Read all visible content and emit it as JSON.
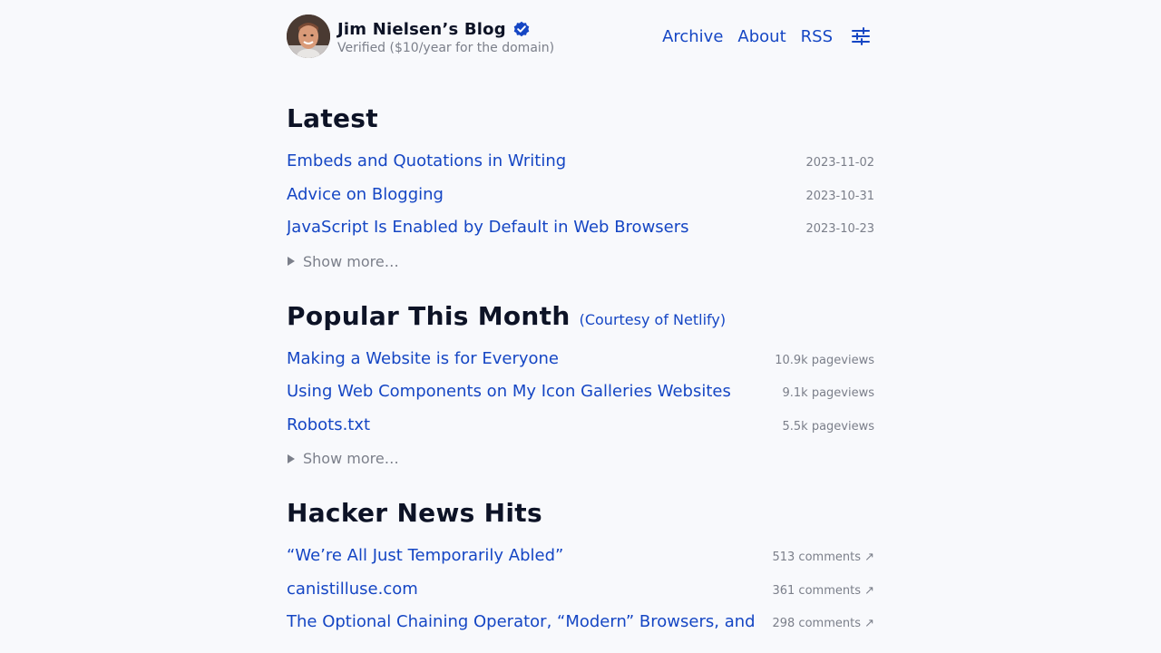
{
  "header": {
    "avatar_alt": "Jim Nielsen",
    "title": "Jim Nielsen’s Blog",
    "verified_icon": "verified-badge-icon",
    "subtitle": "Verified ($10/year for the domain)",
    "nav": {
      "archive": "Archive",
      "about": "About",
      "rss": "RSS",
      "settings_icon": "sliders-icon"
    }
  },
  "latest": {
    "heading": "Latest",
    "posts": [
      {
        "title": "Embeds and Quotations in Writing",
        "meta": "2023-11-02"
      },
      {
        "title": "Advice on Blogging",
        "meta": "2023-10-31"
      },
      {
        "title": "JavaScript Is Enabled by Default in Web Browsers",
        "meta": "2023-10-23"
      }
    ],
    "show_more": "Show more…"
  },
  "popular": {
    "heading": "Popular This Month",
    "courtesy": "(Courtesy of Netlify)",
    "posts": [
      {
        "title": "Making a Website is for Everyone",
        "meta": "10.9k pageviews"
      },
      {
        "title": "Using Web Components on My Icon Galleries Websites",
        "meta": "9.1k pageviews"
      },
      {
        "title": "Robots.txt",
        "meta": "5.5k pageviews"
      }
    ],
    "show_more": "Show more…"
  },
  "hn": {
    "heading": "Hacker News Hits",
    "posts": [
      {
        "title": "“We’re All Just Temporarily Abled”",
        "meta": "513 comments ↗"
      },
      {
        "title": "canistilluse.com",
        "meta": "361 comments ↗"
      },
      {
        "title": "The Optional Chaining Operator, “Modern” Browsers, and",
        "meta": "298 comments ↗"
      }
    ]
  },
  "colors": {
    "background": "#f8f9fc",
    "link": "#1546c4",
    "heading": "#0d1326",
    "muted": "#7b7f8a"
  }
}
